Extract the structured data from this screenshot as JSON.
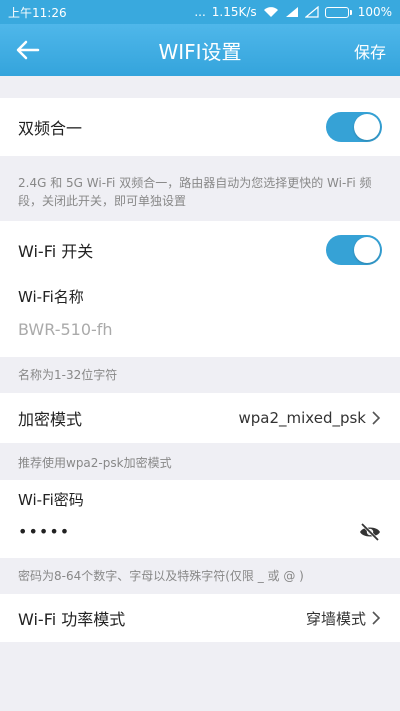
{
  "status": {
    "time": "上午11:26",
    "dots": "...",
    "speed": "1.15K/s",
    "battery": "100%"
  },
  "header": {
    "title": "WIFI设置",
    "save_label": "保存"
  },
  "dualband": {
    "label": "双频合一",
    "enabled": true,
    "hint": "2.4G 和 5G Wi-Fi 双频合一，路由器自动为您选择更快的 Wi-Fi 频段，关闭此开关，即可单独设置"
  },
  "wifi": {
    "switch_label": "Wi-Fi 开关",
    "enabled": true,
    "name_title": "Wi-Fi名称",
    "name_value": "BWR-510-fh",
    "name_hint": "名称为1-32位字符"
  },
  "encryption": {
    "label": "加密模式",
    "value": "wpa2_mixed_psk",
    "hint": "推荐使用wpa2-psk加密模式"
  },
  "password": {
    "title": "Wi-Fi密码",
    "masked": "•••••",
    "hint": "密码为8-64个数字、字母以及特殊字符(仅限 _ 或 @ )"
  },
  "power": {
    "label": "Wi-Fi 功率模式",
    "value": "穿墙模式"
  },
  "colors": {
    "accent": "#36a2d6",
    "header": "#3aa9de",
    "background": "#efeff4"
  }
}
